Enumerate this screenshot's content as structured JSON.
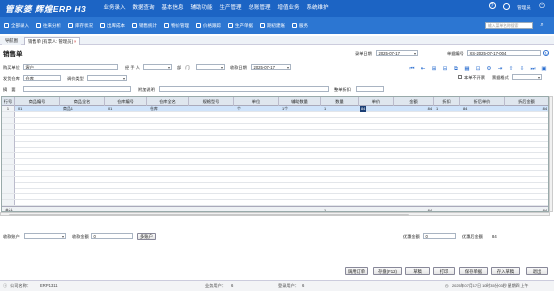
{
  "app": {
    "logo": "管家婆 辉煌ERP H3",
    "menu": [
      "业务录入",
      "数据查询",
      "基本信息",
      "辅助功能",
      "生产管理",
      "总账管理",
      "增值业务",
      "系统维护"
    ],
    "user_label": "管理员",
    "power_label": "退出"
  },
  "toolbar": {
    "items": [
      "全部录入",
      "往来分析",
      "库存状况",
      "出库成本",
      "销售统计",
      "物价管理",
      "价格跟踪",
      "生产单据",
      "期初建账",
      "服务"
    ],
    "search_placeholder": "输入菜单名称搜索"
  },
  "tabs": {
    "nav": "导航图",
    "active": "销售单 [有票人: 管理员]"
  },
  "form": {
    "title": "销售单",
    "labels": {
      "order_date": "录单日期",
      "doc_no": "单据编号",
      "buyer": "购买单位",
      "handler": "经 手 人",
      "dept": "部　门",
      "receive_date": "收款日期",
      "warehouse": "发货仓库",
      "tax_state": "调价类型",
      "summary": "摘　要",
      "attach": "附加说明",
      "price_mode": "整单折扣"
    },
    "values": {
      "order_date": "2025-07-17",
      "doc_no": "XS-2025-07-17-004",
      "buyer": "客户",
      "handler": "",
      "dept": "",
      "receive_date": "2025-07-17",
      "warehouse": "仓库",
      "tax_state": "",
      "summary": "",
      "attach": "",
      "price_mode": ""
    },
    "checks": {
      "not_batch": "本单不开票",
      "print_after": "票据格式"
    }
  },
  "grid": {
    "columns": [
      "行号",
      "商品编号",
      "商品全名",
      "仓库编号",
      "仓库全名",
      "规格型号",
      "单位",
      "辅助数量",
      "数量",
      "单价",
      "金额",
      "折扣",
      "折后单价",
      "折后金额"
    ],
    "rows": [
      [
        "1",
        "01",
        "商品1",
        "01",
        "仓库",
        "",
        "个",
        "1个",
        "1",
        "84",
        "84",
        "1",
        "84",
        "84"
      ]
    ],
    "empty_row_count": 16,
    "footer_label": "合计",
    "footer_qty": "1",
    "footer_amount": "84",
    "footer_disc_amount": "84"
  },
  "bottom": {
    "pay_account_label": "收款账户",
    "pay_account_value": "",
    "pay_amount_label": "收款金额",
    "pay_amount_value": "0",
    "multi_account_button": "多账户",
    "discount_label": "优惠金额",
    "discount_value": "0",
    "after_discount_label": "优惠后金额",
    "after_discount_value": "84"
  },
  "buttons": [
    "调用订单",
    "存盘(F12)",
    "草稿",
    "打印",
    "保存单据",
    "存入草稿",
    "退出"
  ],
  "status": {
    "company_label": "公司名称：",
    "company": "ERP1311",
    "operator_label": "业务用户：",
    "operator": "6",
    "admin_label": "登录用户：",
    "admin": "6",
    "datetime": "2025年07月17日 10时35分03秒 星期四 上午"
  }
}
